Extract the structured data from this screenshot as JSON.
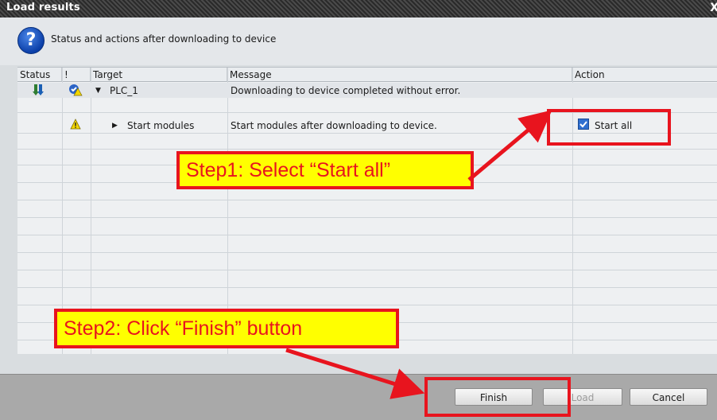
{
  "window": {
    "title": "Load results",
    "close_glyph": "X"
  },
  "header": {
    "subtitle": "Status and actions after downloading to device",
    "icon": "help-icon"
  },
  "table": {
    "columns": [
      "Status",
      "!",
      "Target",
      "Message",
      "Action"
    ],
    "rows": [
      {
        "status_icon": "download-icon",
        "flag_icon": "check-warning-icon",
        "target": "PLC_1",
        "expanded": true,
        "message": "Downloading to device completed without error.",
        "action": ""
      },
      {
        "status_icon": "",
        "flag_icon": "warning-icon",
        "target": "Start modules",
        "expanded": false,
        "message": "Start modules after downloading to device.",
        "action": "Start all",
        "action_checked": true
      }
    ]
  },
  "annotations": {
    "step1": "Step1: Select “Start all”",
    "step2": "Step2: Click “Finish” button"
  },
  "buttons": {
    "finish": "Finish",
    "load": "Load",
    "cancel": "Cancel"
  },
  "colors": {
    "callout_bg": "#ffff00",
    "highlight_red": "#e8141e"
  }
}
